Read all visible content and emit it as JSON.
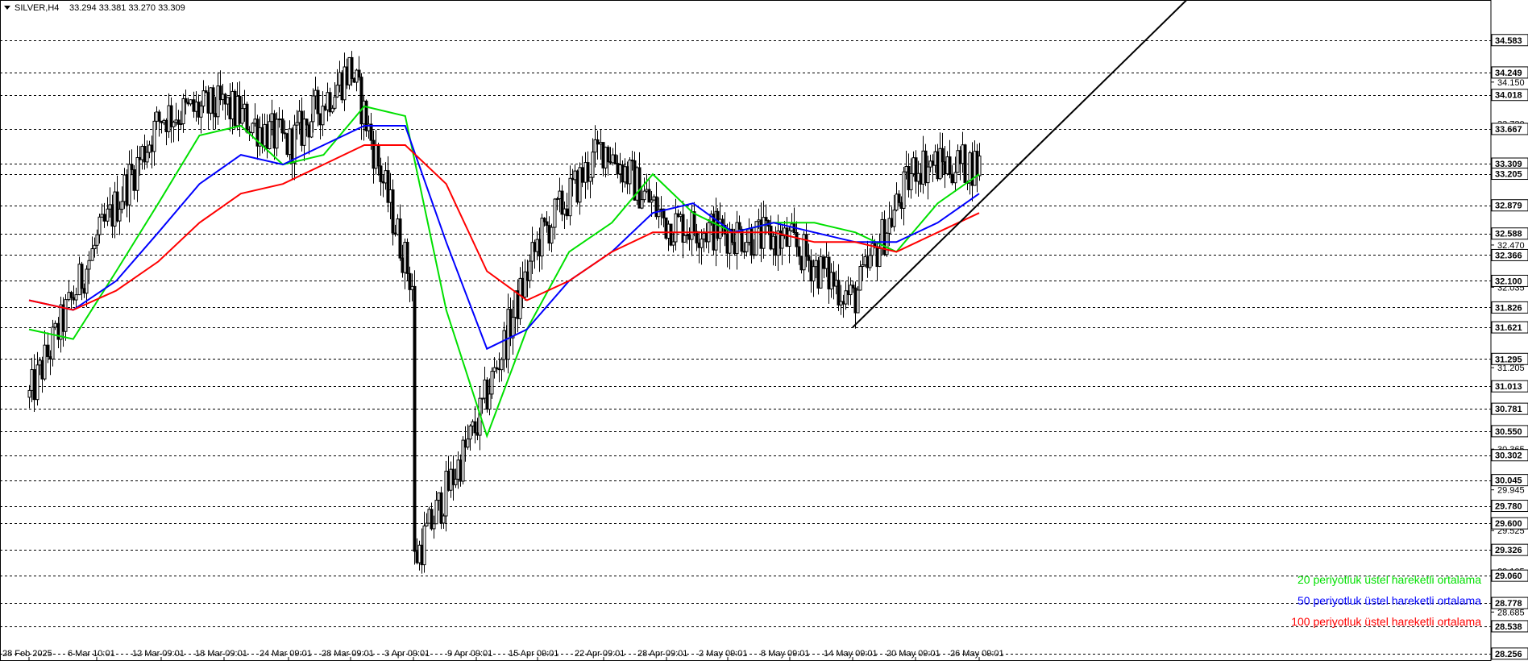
{
  "header": {
    "symbol_label": "SILVER,H4",
    "ohlc": "33.294 33.381 33.270 33.309"
  },
  "legend": [
    {
      "text": "20 periyotluk üstel hareketli ortalama",
      "color": "#00e000"
    },
    {
      "text": "50 periyotluk üstel hareketli ortalama",
      "color": "#0000ff"
    },
    {
      "text": "100 periyotluk üstel hareketli ortalama",
      "color": "#ff0000"
    }
  ],
  "chart_data": {
    "type": "candlestick",
    "ylim": [
      28.18,
      34.98
    ],
    "grid": false,
    "price_levels": [
      34.583,
      34.249,
      34.018,
      33.667,
      33.309,
      33.205,
      32.879,
      32.588,
      32.366,
      32.1,
      31.826,
      31.621,
      31.295,
      31.013,
      30.781,
      30.55,
      30.302,
      30.045,
      29.78,
      29.6,
      29.326,
      29.06,
      28.778,
      28.538,
      28.256
    ],
    "price_level_labels": [
      "34.583",
      "34.249",
      "34.018",
      "33.667",
      "33.309",
      "33.205",
      "32.879",
      "32.588",
      "32.366",
      "32.100",
      "31.826",
      "31.621",
      "31.295",
      "31.013",
      "30.781",
      "30.550",
      "30.302",
      "30.045",
      "29.780",
      "29.600",
      "29.326",
      "29.060",
      "28.778",
      "28.538",
      "28.256"
    ],
    "axis_ticks": [
      "34.150",
      "33.720",
      "32.470",
      "32.035",
      "31.205",
      "30.365",
      "29.945",
      "29.525",
      "29.105",
      "28.685"
    ],
    "x_tick_labels": [
      "28 Feb 2025",
      "6 Mar 10:01",
      "12 Mar 09:01",
      "18 Mar 09:01",
      "24 Mar 09:01",
      "28 Mar 09:01",
      "3 Apr 09:01",
      "9 Apr 09:01",
      "15 Apr 09:01",
      "22 Apr 09:01",
      "28 Apr 09:01",
      "2 May 09:01",
      "8 May 09:01",
      "14 May 09:01",
      "20 May 09:01",
      "26 May 09:01"
    ],
    "path_points": [
      [
        "28 Feb 2025",
        30.9
      ],
      [
        "6 Mar 10:01",
        32.5
      ],
      [
        "12 Mar 09:01",
        33.8
      ],
      [
        "18 Mar 09:01",
        33.9
      ],
      [
        "24 Mar 09:01",
        33.5
      ],
      [
        "28 Mar 09:01",
        34.3
      ],
      [
        "3 Apr 09:01",
        32.0
      ],
      [
        "3 Apr 09:01",
        29.2
      ],
      [
        "9 Apr 09:01",
        30.6
      ],
      [
        "15 Apr 09:01",
        32.5
      ],
      [
        "22 Apr 09:01",
        33.5
      ],
      [
        "28 Apr 09:01",
        32.7
      ],
      [
        "2 May 09:01",
        32.6
      ],
      [
        "8 May 09:01",
        32.5
      ],
      [
        "14 May 09:01",
        31.9
      ],
      [
        "20 May 09:01",
        33.3
      ],
      [
        "26 May 09:01",
        33.3
      ]
    ],
    "series": [
      {
        "name": "20 periyotluk üstel hareketli ortalama",
        "color": "#00e000",
        "values": [
          31.6,
          31.5,
          32.2,
          32.9,
          33.6,
          33.7,
          33.3,
          33.4,
          33.9,
          33.8,
          31.8,
          30.5,
          31.6,
          32.4,
          32.7,
          33.2,
          32.8,
          32.6,
          32.7,
          32.7,
          32.6,
          32.4,
          32.9,
          33.2
        ]
      },
      {
        "name": "50 periyotluk üstel hareketli ortalama",
        "color": "#0000ff",
        "values": [
          31.9,
          31.8,
          32.1,
          32.6,
          33.1,
          33.4,
          33.3,
          33.5,
          33.7,
          33.7,
          32.5,
          31.4,
          31.6,
          32.1,
          32.4,
          32.8,
          32.9,
          32.6,
          32.7,
          32.6,
          32.5,
          32.5,
          32.7,
          33.0
        ]
      },
      {
        "name": "100 periyotluk üstel hareketli ortalama",
        "color": "#ff0000",
        "values": [
          31.9,
          31.8,
          32.0,
          32.3,
          32.7,
          33.0,
          33.1,
          33.3,
          33.5,
          33.5,
          33.1,
          32.2,
          31.9,
          32.1,
          32.4,
          32.6,
          32.6,
          32.6,
          32.6,
          32.5,
          32.5,
          32.4,
          32.6,
          32.8
        ]
      }
    ],
    "trendline": {
      "from": [
        "14 May 09:01",
        31.621
      ],
      "to": [
        "26 May 09:01",
        32.9
      ]
    }
  }
}
